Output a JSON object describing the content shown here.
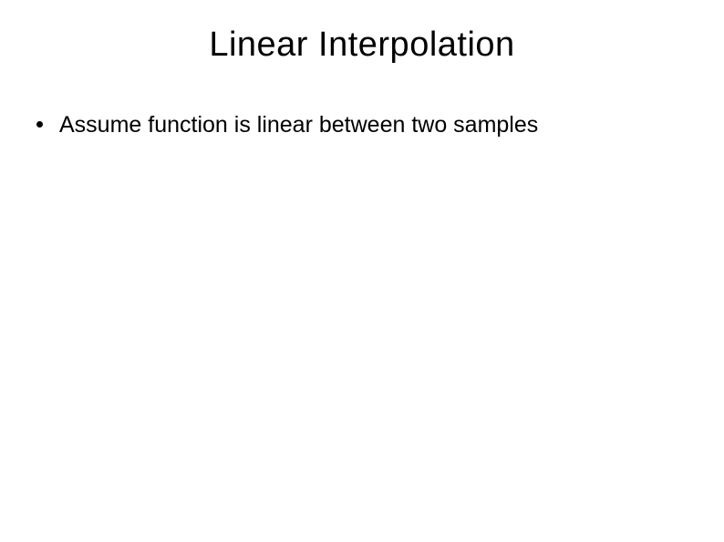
{
  "slide": {
    "title": "Linear Interpolation",
    "bullets": [
      {
        "text": "Assume function is linear between two samples"
      }
    ]
  }
}
